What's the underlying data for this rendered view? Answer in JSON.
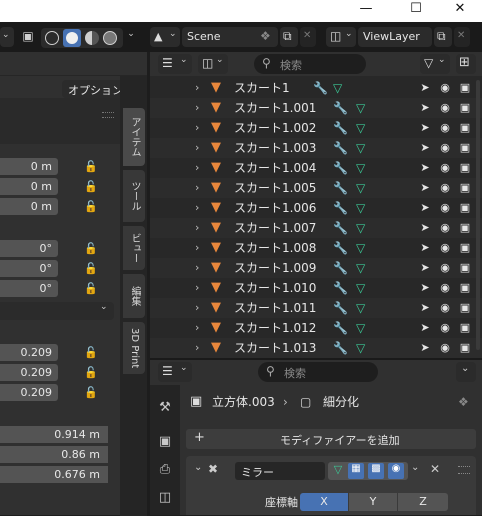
{
  "topbar": {
    "scene_label": "Scene",
    "view_layer_label": "ViewLayer"
  },
  "left_panel": {
    "options_label": "オプション",
    "location": [
      "0 m",
      "0 m",
      "0 m"
    ],
    "rotation": [
      "0°",
      "0°",
      "0°"
    ],
    "scale": [
      "0.209",
      "0.209",
      "0.209"
    ],
    "dimensions": [
      "0.914 m",
      "0.86 m",
      "0.676 m"
    ]
  },
  "tabs": [
    "アイテム",
    "ツール",
    "ビュー",
    "編集",
    "3D Print"
  ],
  "outliner": {
    "search_placeholder": "検索",
    "rows": [
      "スカート1",
      "スカート1.001",
      "スカート1.002",
      "スカート1.003",
      "スカート1.004",
      "スカート1.005",
      "スカート1.006",
      "スカート1.007",
      "スカート1.008",
      "スカート1.009",
      "スカート1.010",
      "スカート1.011",
      "スカート1.012",
      "スカート1.013"
    ]
  },
  "properties": {
    "search_placeholder": "検索",
    "object_name": "立方体.003",
    "modifier_context": "細分化",
    "add_modifier_label": "モディファイアーを追加",
    "modifier_name": "ミラー",
    "axis_label": "座標軸",
    "axis_buttons": [
      "X",
      "Y",
      "Z"
    ]
  },
  "colors": {
    "accent_blue": "#4772b3",
    "object_orange": "#e8873c",
    "mesh_green": "#3bc896",
    "modifier_blue": "#6f9fdf"
  }
}
